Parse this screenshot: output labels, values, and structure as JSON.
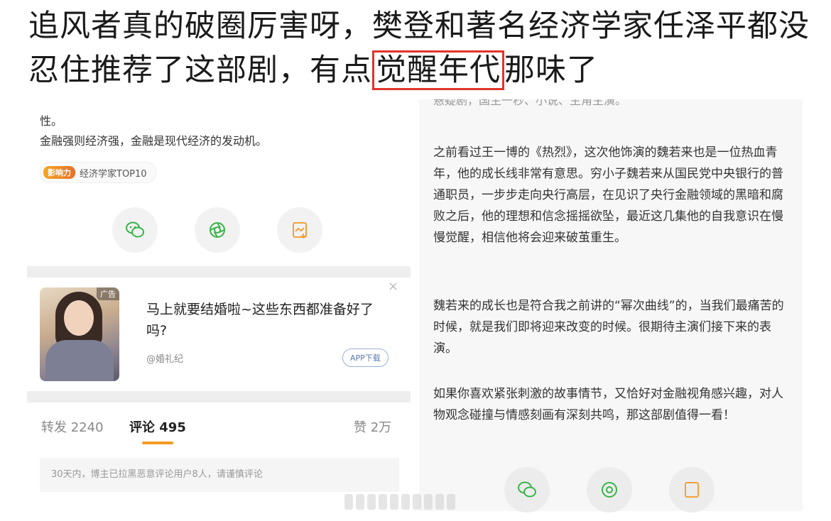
{
  "headline": {
    "before": "追风者真的破圈厉害呀，樊登和著名经济学家任泽平都没忍住推荐了这部剧，有点",
    "highlight": "觉醒年代",
    "after": "那味了"
  },
  "left_post": {
    "line1": "性。",
    "line2": "金融强则经济强，金融是现代经济的发动机。",
    "badge_level": "影响力",
    "badge_label": "经济学家TOP10"
  },
  "ad": {
    "tag": "广告",
    "title": "马上就要结婚啦~这些东西都准备好了吗?",
    "source": "@婚礼纪",
    "button": "APP下载",
    "close": "×"
  },
  "tabs": {
    "repost": "转发 2240",
    "comments": "评论 495",
    "likes": "赞 2万"
  },
  "notice": "30天内，博主已拉黑恶意评论用户8人，请谨慎评论",
  "right_post": {
    "top_cut": "悬疑剧，国主一秒、小说、主角主演。",
    "p1": "之前看过王一博的《热烈》，这次他饰演的魏若来也是一位热血青年，他的成长线非常有意思。穷小子魏若来从国民党中央银行的普通职员，一步步走向央行高层，在见识了央行金融领域的黑暗和腐败之后，他的理想和信念摇摇欲坠，最近这几集他的自我意识在慢慢觉醒，相信他将会迎来破茧重生。",
    "p2": "魏若来的成长也是符合我之前讲的“幂次曲线”的，当我们最痛苦的时候，就是我们即将迎来改变的时候。很期待主演们接下来的表演。",
    "p3": "如果你喜欢紧张刺激的故事情节，又恰好对金融视角感兴趣，对人物观念碰撞与情感刻画有深刻共鸣，那这部剧值得一看！"
  },
  "colors": {
    "highlight_border": "#e0352b",
    "tab_underline": "#f59a23",
    "wechat": "#3bb34a",
    "moments": "#3bb34a",
    "save": "#f3a33c"
  },
  "icons": [
    "wechat-icon",
    "moments-icon",
    "save-icon"
  ]
}
